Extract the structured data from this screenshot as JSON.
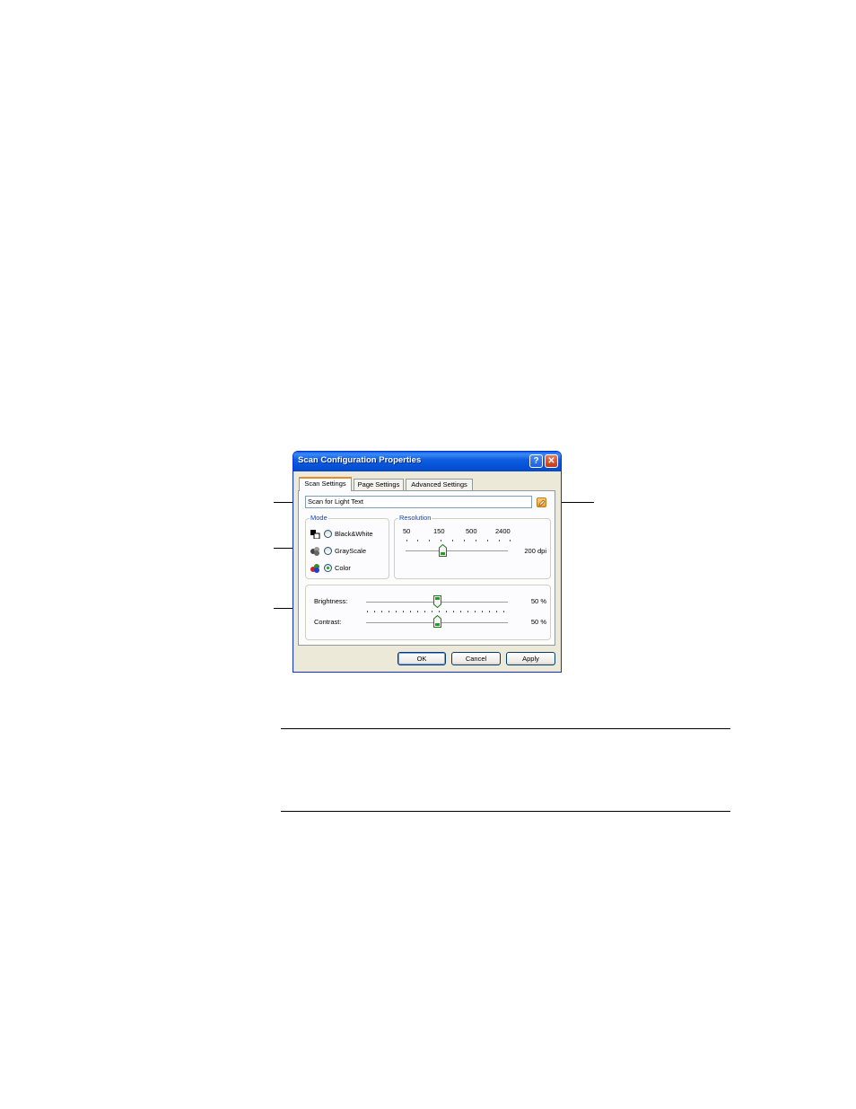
{
  "window": {
    "title": "Scan Configuration Properties",
    "help_label": "?",
    "close_label": "✕"
  },
  "tabs": [
    {
      "label": "Scan Settings",
      "selected": true
    },
    {
      "label": "Page Settings",
      "selected": false
    },
    {
      "label": "Advanced Settings",
      "selected": false
    }
  ],
  "config_name": {
    "value": "Scan for Light Text"
  },
  "mode": {
    "label": "Mode",
    "options": [
      {
        "label": "Black&White",
        "icon": "black-white-icon",
        "checked": false
      },
      {
        "label": "GrayScale",
        "icon": "grayscale-icon",
        "checked": false
      },
      {
        "label": "Color",
        "icon": "color-icon",
        "checked": true
      }
    ]
  },
  "resolution": {
    "label": "Resolution",
    "tick_labels": [
      "50",
      "150",
      "500",
      "2400"
    ],
    "value_text": "200 dpi"
  },
  "adjustments": {
    "brightness_label": "Brightness:",
    "brightness_value": "50 %",
    "contrast_label": "Contrast:",
    "contrast_value": "50 %"
  },
  "buttons": {
    "ok": "OK",
    "cancel": "Cancel",
    "apply": "Apply"
  },
  "colors": {
    "titlebar": "#0a5fe0",
    "dialog_bg": "#ece9d8",
    "group_label": "#0046d5",
    "active_tab_accent": "#e68b2c",
    "slider_thumb": "#21a121"
  }
}
